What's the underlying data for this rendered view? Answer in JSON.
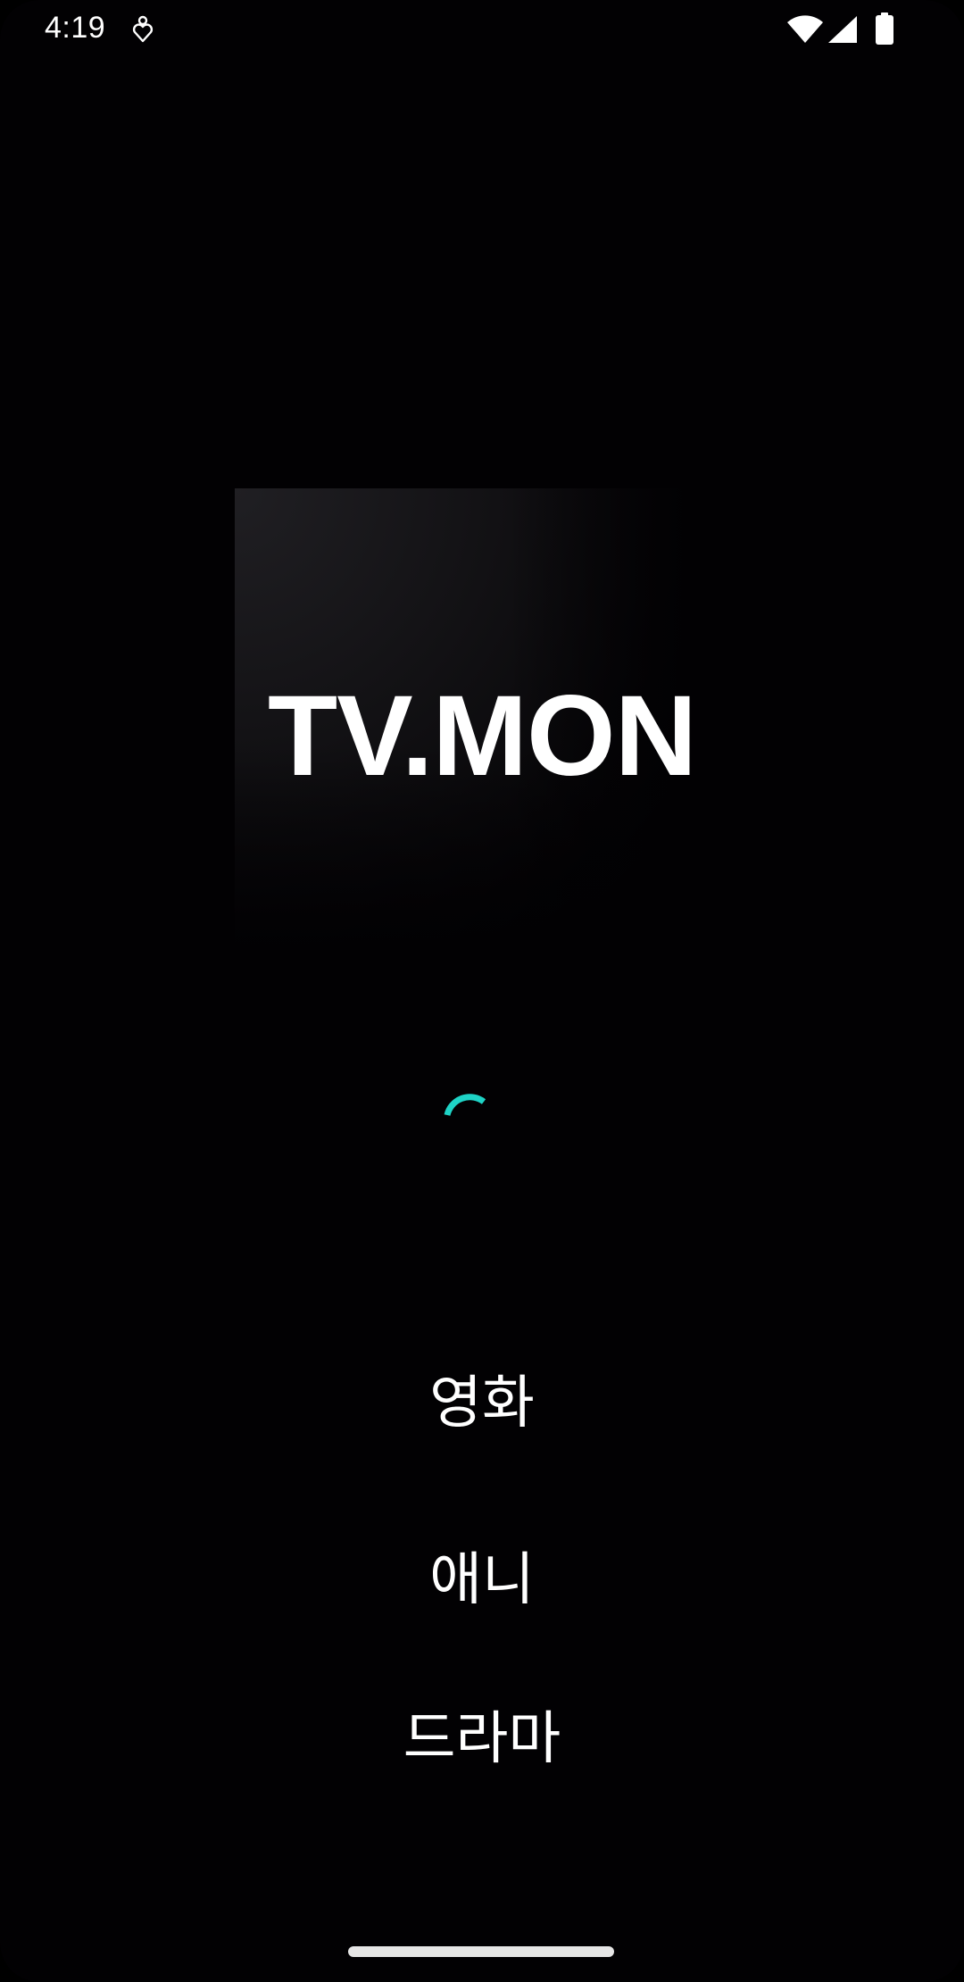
{
  "status_bar": {
    "time": "4:19",
    "icons": [
      "notification-icon",
      "wifi-icon",
      "cellular-signal-icon",
      "battery-icon"
    ]
  },
  "splash": {
    "logo_text": "TV.MON",
    "spinner_color": "#1ed3c6"
  },
  "categories": [
    {
      "label": "영화"
    },
    {
      "label": "애니"
    },
    {
      "label": "드라마"
    }
  ],
  "colors": {
    "background": "#020103",
    "text": "#ffffff",
    "accent": "#1ed3c6"
  }
}
